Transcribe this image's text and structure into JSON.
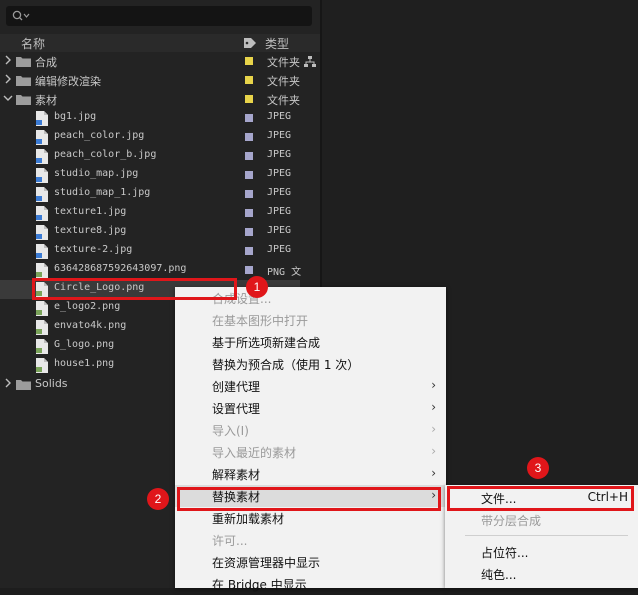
{
  "columns": {
    "name": "名称",
    "type": "类型"
  },
  "tree": [
    {
      "label": "合成",
      "type": "文件夹",
      "kind": "folder",
      "expanded": false,
      "swatch": "#e8d44a"
    },
    {
      "label": "编辑修改渲染",
      "type": "文件夹",
      "kind": "folder",
      "expanded": false,
      "swatch": "#e8d44a"
    },
    {
      "label": "素材",
      "type": "文件夹",
      "kind": "folder",
      "expanded": true,
      "swatch": "#e8d44a"
    },
    {
      "label": "bg1.jpg",
      "type": "JPEG",
      "kind": "jpg",
      "swatch": "#a6a6cc"
    },
    {
      "label": "peach_color.jpg",
      "type": "JPEG",
      "kind": "jpg",
      "swatch": "#a6a6cc"
    },
    {
      "label": "peach_color_b.jpg",
      "type": "JPEG",
      "kind": "jpg",
      "swatch": "#a6a6cc"
    },
    {
      "label": "studio_map.jpg",
      "type": "JPEG",
      "kind": "jpg",
      "swatch": "#a6a6cc"
    },
    {
      "label": "studio_map_1.jpg",
      "type": "JPEG",
      "kind": "jpg",
      "swatch": "#a6a6cc"
    },
    {
      "label": "texture1.jpg",
      "type": "JPEG",
      "kind": "jpg",
      "swatch": "#a6a6cc"
    },
    {
      "label": "texture8.jpg",
      "type": "JPEG",
      "kind": "jpg",
      "swatch": "#a6a6cc"
    },
    {
      "label": "texture-2.jpg",
      "type": "JPEG",
      "kind": "jpg",
      "swatch": "#a6a6cc"
    },
    {
      "label": "636428687592643097.png",
      "type": "PNG 文",
      "kind": "png",
      "swatch": "#a6a6cc"
    },
    {
      "label": "Circle_Logo.png",
      "type": "",
      "kind": "png",
      "swatch": "",
      "selected": true
    },
    {
      "label": "e_logo2.png",
      "type": "",
      "kind": "png",
      "swatch": ""
    },
    {
      "label": "envato4k.png",
      "type": "",
      "kind": "png",
      "swatch": ""
    },
    {
      "label": "G_logo.png",
      "type": "",
      "kind": "png",
      "swatch": ""
    },
    {
      "label": "house1.png",
      "type": "",
      "kind": "png",
      "swatch": ""
    },
    {
      "label": "Solids",
      "type": "",
      "kind": "folder",
      "expanded": false,
      "swatch": ""
    }
  ],
  "context_menu": [
    {
      "label": "合成设置...",
      "disabled": true,
      "submenu": false
    },
    {
      "label": "在基本图形中打开",
      "disabled": true,
      "submenu": false
    },
    {
      "label": "基于所选项新建合成",
      "disabled": false,
      "submenu": false
    },
    {
      "label": "替换为预合成（使用 1 次）",
      "disabled": false,
      "submenu": false
    },
    {
      "label": "创建代理",
      "disabled": false,
      "submenu": true
    },
    {
      "label": "设置代理",
      "disabled": false,
      "submenu": true
    },
    {
      "label": "导入(I)",
      "disabled": true,
      "submenu": true
    },
    {
      "label": "导入最近的素材",
      "disabled": true,
      "submenu": true
    },
    {
      "label": "解释素材",
      "disabled": false,
      "submenu": true
    },
    {
      "label": "替换素材",
      "disabled": false,
      "submenu": true,
      "highlighted": true
    },
    {
      "label": "重新加载素材",
      "disabled": false,
      "submenu": false
    },
    {
      "label": "许可...",
      "disabled": true,
      "submenu": false
    },
    {
      "label": "在资源管理器中显示",
      "disabled": false,
      "submenu": false
    },
    {
      "label": "在 Bridge 中显示",
      "disabled": false,
      "submenu": false
    }
  ],
  "submenu": {
    "file": {
      "label": "文件...",
      "shortcut": "Ctrl+H"
    },
    "layered": {
      "label": "带分层合成",
      "disabled": true
    },
    "placeholder": {
      "label": "占位符..."
    },
    "solid": {
      "label": "纯色..."
    }
  },
  "badges": [
    "1",
    "2",
    "3"
  ],
  "colors": {
    "callout": "#e0161a",
    "folder_swatch": "#e8d44a",
    "file_swatch": "#a6a6cc"
  }
}
